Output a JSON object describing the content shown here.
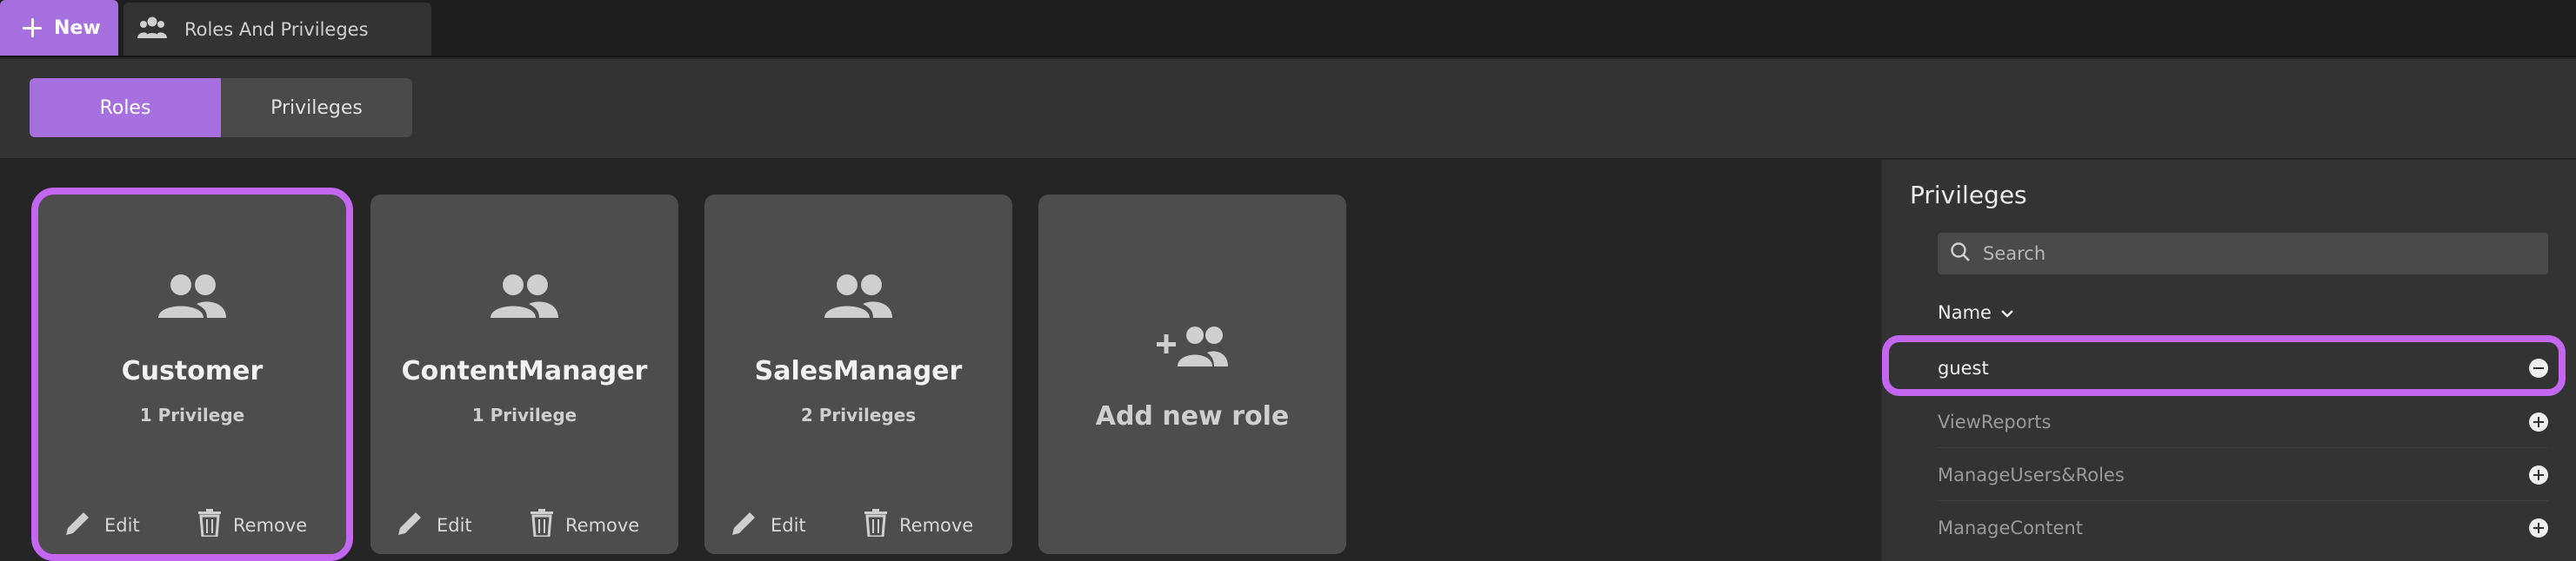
{
  "header": {
    "new_label": "New",
    "tab_title": "Roles And Privileges",
    "tab_icon": "group-icon"
  },
  "toggle": {
    "roles_label": "Roles",
    "privileges_label": "Privileges",
    "active": "Roles"
  },
  "roles": [
    {
      "name": "Customer",
      "count": "1 Privilege",
      "selected": true
    },
    {
      "name": "ContentManager",
      "count": "1 Privilege",
      "selected": false
    },
    {
      "name": "SalesManager",
      "count": "2 Privileges",
      "selected": false
    }
  ],
  "role_actions": {
    "edit_label": "Edit",
    "remove_label": "Remove"
  },
  "add_role": {
    "label": "Add new role"
  },
  "panel": {
    "title": "Privileges",
    "search_placeholder": "Search",
    "sort_label": "Name",
    "items": [
      {
        "name": "guest",
        "assigned": true
      },
      {
        "name": "ViewReports",
        "assigned": false
      },
      {
        "name": "ManageUsers&Roles",
        "assigned": false
      },
      {
        "name": "ManageContent",
        "assigned": false
      }
    ]
  },
  "colors": {
    "accent": "#a670e0",
    "selection_outline": "#c366f0",
    "card_bg": "#4d4d4d",
    "panel_bg": "#333333",
    "page_bg": "#252525"
  }
}
